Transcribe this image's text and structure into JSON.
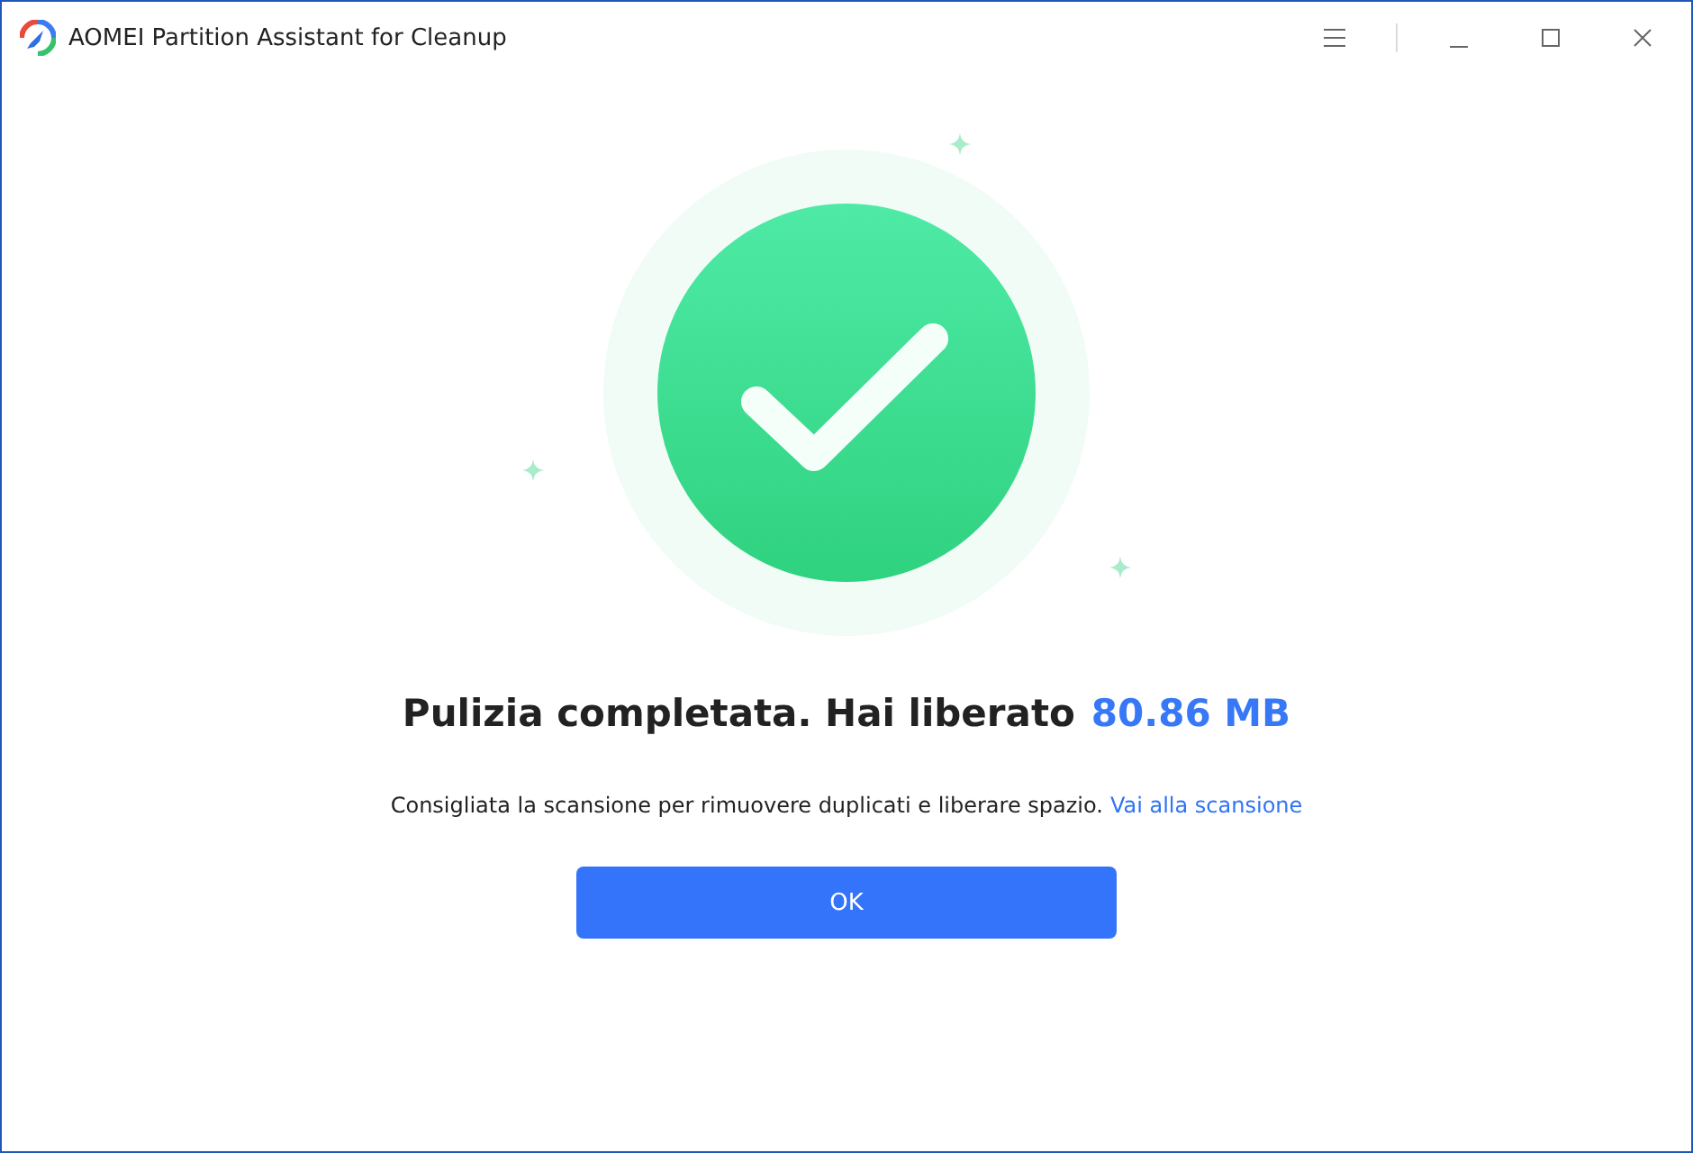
{
  "window": {
    "title": "AOMEI Partition Assistant for Cleanup"
  },
  "result": {
    "headline": "Pulizia completata. Hai liberato",
    "amount": "80.86 MB"
  },
  "recommendation": {
    "text": "Consigliata la scansione per rimuovere duplicati e liberare spazio.",
    "link": "Vai alla scansione"
  },
  "buttons": [
    "OK"
  ]
}
